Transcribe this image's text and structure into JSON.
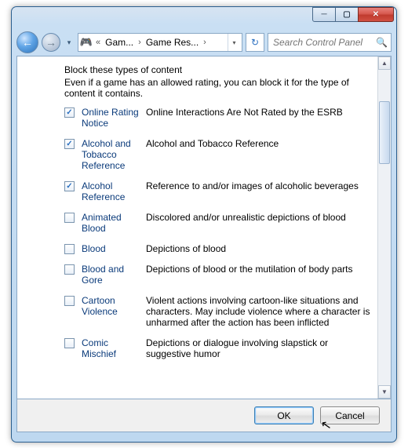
{
  "titlebar": {
    "minimize_icon": "─",
    "maximize_icon": "▢",
    "close_icon": "✕"
  },
  "nav": {
    "back_icon": "←",
    "forward_icon": "→",
    "dropdown_icon": "▾",
    "address_chev": "«",
    "seg1": "Gam...",
    "seg_sep": "›",
    "seg2": "Game Res...",
    "addr_dd": "▾",
    "refresh_icon": "↻",
    "search_placeholder": "Search Control Panel",
    "search_icon": "🔍"
  },
  "content": {
    "heading": "Block these types of content",
    "subtext": "Even if a game has an allowed rating, you can block it for the type of content it contains.",
    "items": [
      {
        "checked": true,
        "term": "Online Rating Notice",
        "desc": "Online Interactions Are Not Rated by the ESRB"
      },
      {
        "checked": true,
        "term": "Alcohol and Tobacco Reference",
        "desc": "Alcohol and Tobacco Reference"
      },
      {
        "checked": true,
        "term": "Alcohol Reference",
        "desc": "Reference to and/or images of alcoholic beverages"
      },
      {
        "checked": false,
        "term": "Animated Blood",
        "desc": "Discolored and/or unrealistic depictions of blood"
      },
      {
        "checked": false,
        "term": "Blood",
        "desc": "Depictions of blood"
      },
      {
        "checked": false,
        "term": "Blood and Gore",
        "desc": "Depictions of blood or the mutilation of body parts"
      },
      {
        "checked": false,
        "term": "Cartoon Violence",
        "desc": "Violent actions involving cartoon-like situations and characters. May include violence where a character is unharmed after the action has been inflicted"
      },
      {
        "checked": false,
        "term": "Comic Mischief",
        "desc": "Depictions or dialogue involving slapstick or suggestive humor"
      }
    ]
  },
  "footer": {
    "ok": "OK",
    "cancel": "Cancel"
  },
  "scrollbar": {
    "up": "▲",
    "down": "▼"
  }
}
